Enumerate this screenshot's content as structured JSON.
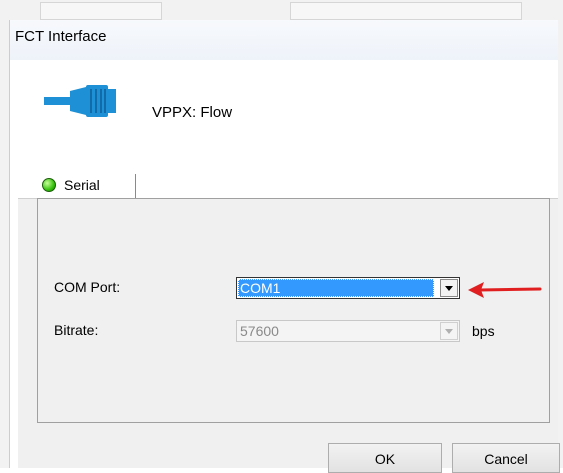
{
  "window": {
    "title": "FCT Interface"
  },
  "header": {
    "device_label": "VPPX: Flow",
    "icon": "serial-connector-icon"
  },
  "tabs": [
    {
      "label": "Serial",
      "status": "connected",
      "status_color": "#35c20d",
      "selected": true
    }
  ],
  "serial": {
    "com_port": {
      "label": "COM Port:",
      "value": "COM1",
      "highlighted": true
    },
    "bitrate": {
      "label": "Bitrate:",
      "value": "57600",
      "unit": "bps",
      "disabled": true
    }
  },
  "buttons": {
    "ok": "OK",
    "cancel": "Cancel"
  },
  "annotation": {
    "type": "arrow",
    "color": "#e02020",
    "points_to": "com_port"
  },
  "colors": {
    "selection": "#3399ff",
    "icon": "#1e90d6"
  }
}
